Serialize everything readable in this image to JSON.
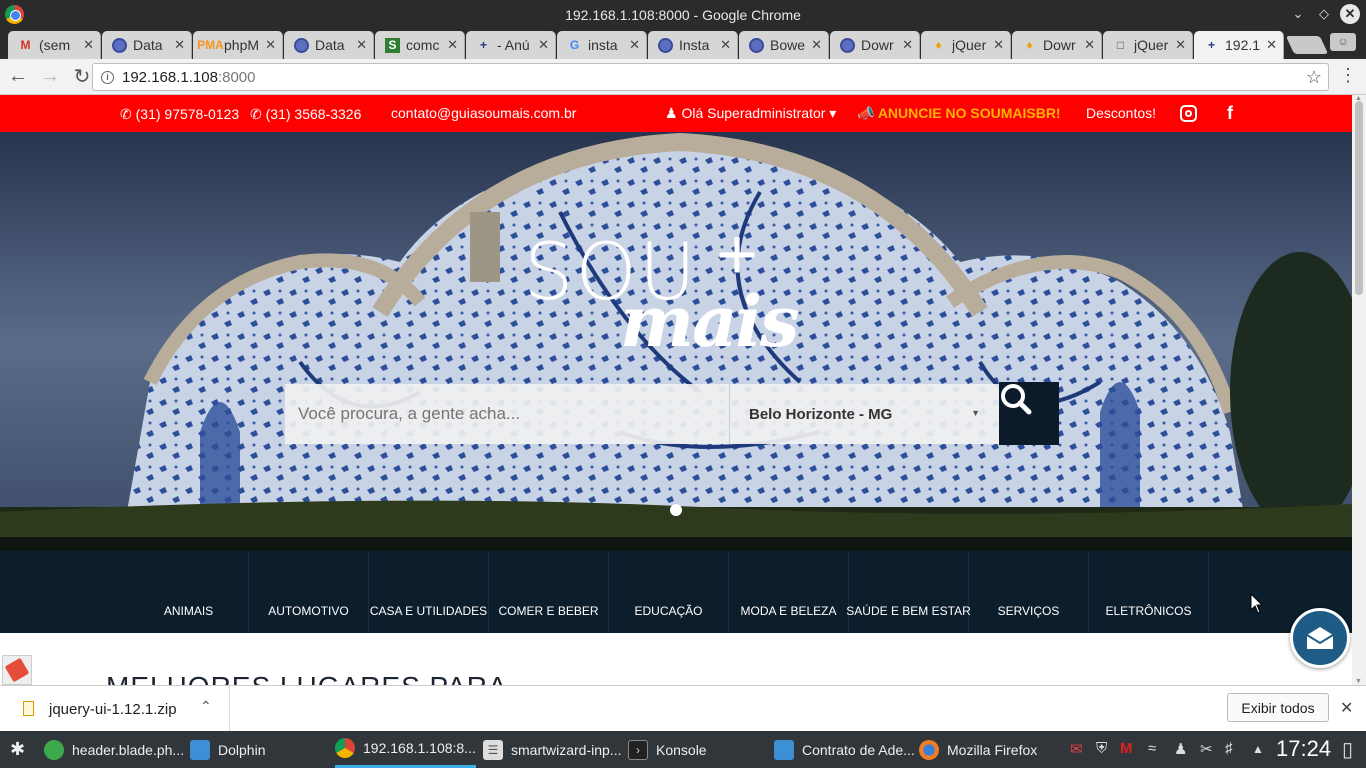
{
  "window": {
    "title": "192.168.1.108:8000 - Google Chrome"
  },
  "tabs": [
    {
      "label": "(sem",
      "icon": "gmail-icon"
    },
    {
      "label": "Data",
      "icon": "globe-icon"
    },
    {
      "label": "phpM",
      "icon": "phpmyadmin-icon"
    },
    {
      "label": "Data",
      "icon": "globe-icon"
    },
    {
      "label": "comc",
      "icon": "composer-icon"
    },
    {
      "label": "- Anú",
      "icon": "plus-icon"
    },
    {
      "label": "insta",
      "icon": "google-icon"
    },
    {
      "label": "Insta",
      "icon": "globe-icon"
    },
    {
      "label": "Bowe",
      "icon": "globe-icon"
    },
    {
      "label": "Dowr",
      "icon": "globe-icon"
    },
    {
      "label": "jQuer",
      "icon": "shield-icon"
    },
    {
      "label": "Dowr",
      "icon": "shield-icon"
    },
    {
      "label": "jQuer",
      "icon": "document-icon"
    },
    {
      "label": "192.1",
      "icon": "plus-icon"
    }
  ],
  "address_bar": {
    "host": "192.168.1.108",
    "port": ":8000"
  },
  "site": {
    "topbar": {
      "whatsapp": "(31) 97578-0123",
      "phone": "(31) 3568-3326",
      "email": "contato@guiasoumais.com.br",
      "user_menu": "Olá Superadministrator",
      "advertise": "ANUNCIE NO SOUMAISBR!",
      "discounts": "Descontos!"
    },
    "logo": {
      "top": "SOU",
      "plus": "+",
      "bottom": "mais"
    },
    "search": {
      "placeholder": "Você procura, a gente acha...",
      "city": "Belo Horizonte - MG"
    },
    "categories": [
      "ANIMAIS",
      "AUTOMOTIVO",
      "CASA E UTILIDADES",
      "COMER E BEBER",
      "EDUCAÇÃO",
      "MODA E BELEZA",
      "SAÚDE E BEM ESTAR",
      "SERVIÇOS",
      "ELETRÔNICOS"
    ],
    "section_title": "MELHORES LUGARES PARA"
  },
  "download_bar": {
    "file": "jquery-ui-1.12.1.zip",
    "show_all": "Exibir todos"
  },
  "taskbar": {
    "items": [
      {
        "label": "header.blade.ph..."
      },
      {
        "label": "Dolphin"
      },
      {
        "label": "192.168.1.108:8..."
      },
      {
        "label": "smartwizard-inp..."
      },
      {
        "label": "Konsole"
      },
      {
        "label": "Contrato de Ade..."
      },
      {
        "label": "Mozilla Firefox"
      }
    ],
    "clock": "17:24"
  },
  "colors": {
    "topbar_red": "#ff0000",
    "advertise_orange": "#ffb400",
    "nav_navy": "#0c1d2c",
    "mail_fab_blue": "#1e5c86"
  }
}
